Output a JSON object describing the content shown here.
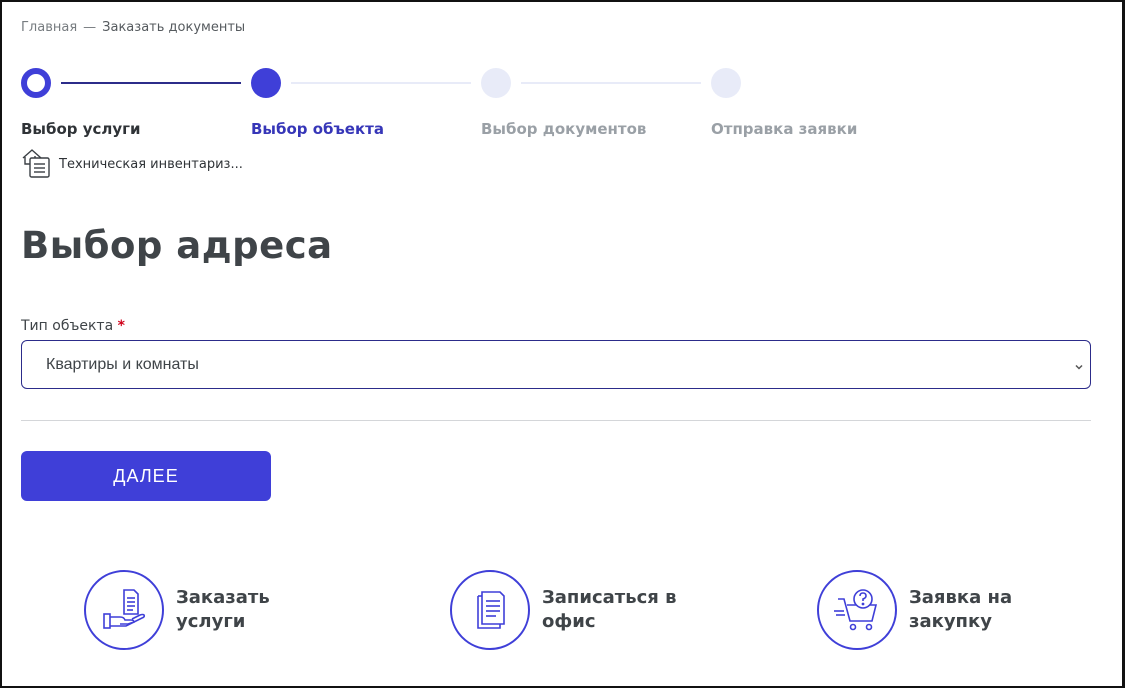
{
  "breadcrumb": {
    "home": "Главная",
    "separator": "—",
    "current": "Заказать документы"
  },
  "steps": [
    {
      "label": "Выбор услуги",
      "state": "done"
    },
    {
      "label": "Выбор объекта",
      "state": "active"
    },
    {
      "label": "Выбор документов",
      "state": "todo"
    },
    {
      "label": "Отправка заявки",
      "state": "todo"
    }
  ],
  "service": {
    "name": "Техническая инвентариз...",
    "icon": "house-document-icon"
  },
  "page_title": "Выбор адреса",
  "object_type": {
    "label": "Тип объекта",
    "required_mark": "*",
    "value": "Квартиры и комнаты"
  },
  "next_button": "ДАЛЕЕ",
  "actions": [
    {
      "line1": "Заказать",
      "line2": "услуги",
      "icon": "hand-document-icon"
    },
    {
      "line1": "Записаться в",
      "line2": "офис",
      "icon": "documents-icon"
    },
    {
      "line1": "Заявка на",
      "line2": "закупку",
      "icon": "cart-question-icon"
    }
  ],
  "colors": {
    "accent": "#3f3fd8",
    "accent_dark": "#2c2c8a",
    "inactive": "#e8ebf8",
    "text": "#3f4448",
    "muted": "#9aa0a6"
  }
}
